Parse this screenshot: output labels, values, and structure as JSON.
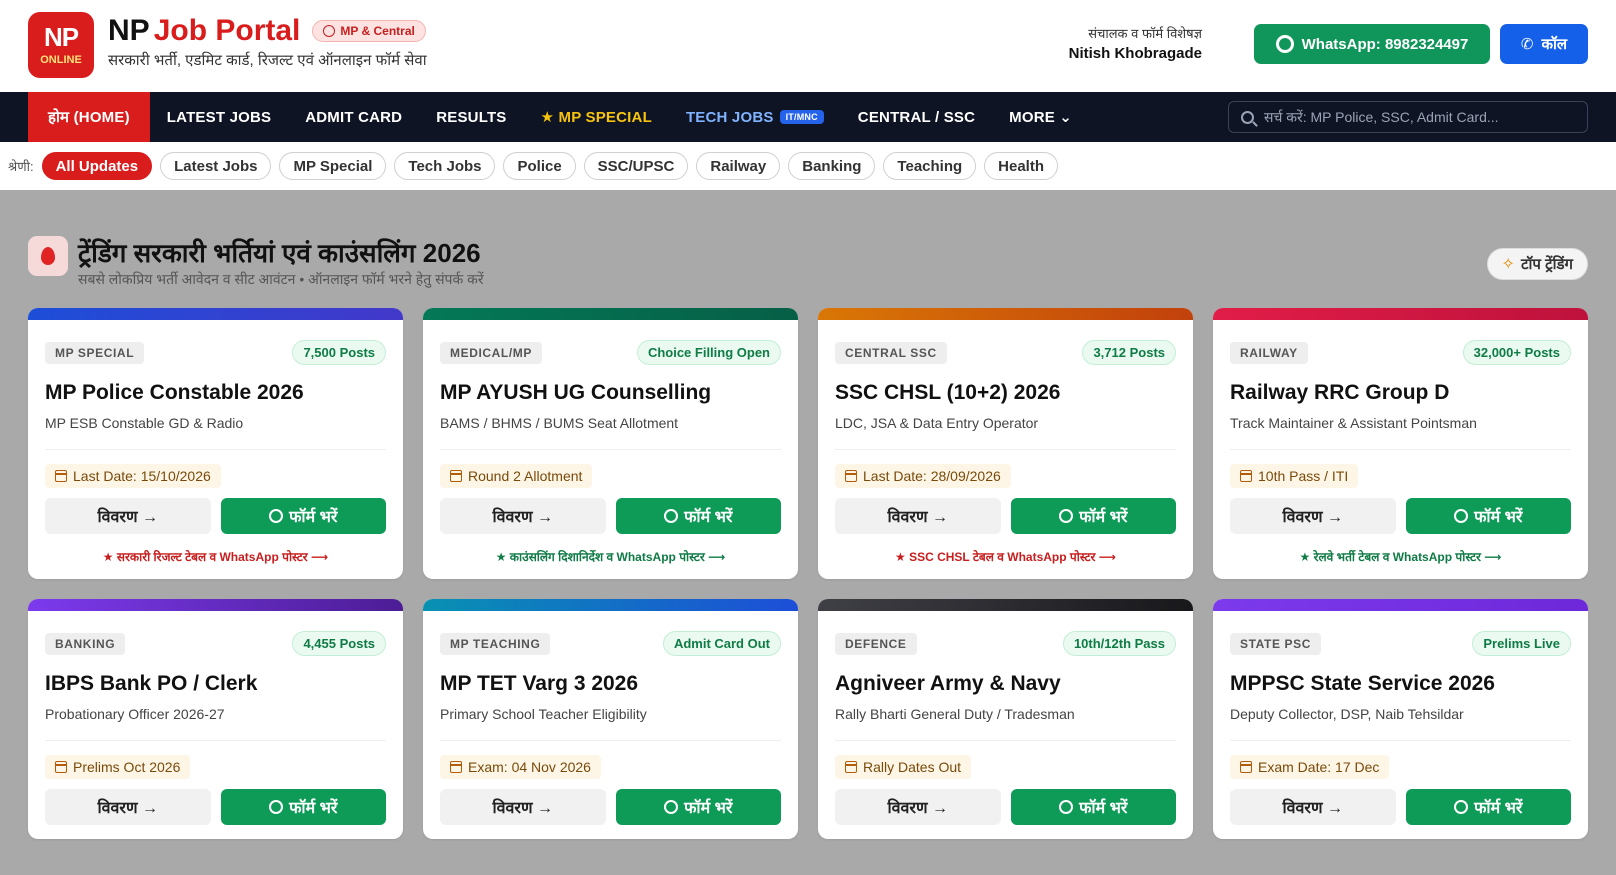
{
  "header": {
    "logo_line1": "NP",
    "logo_line2": "ONLINE",
    "brand_np": "NP",
    "brand_jp": "Job Portal",
    "badge": "MP & Central",
    "subtitle": "सरकारी भर्ती, एडमिट कार्ड, रिजल्ट एवं ऑनलाइन फॉर्म सेवा",
    "director_label": "संचालक व फॉर्म विशेषज्ञ",
    "director_name": "Nitish Khobragade",
    "whatsapp": "WhatsApp: 8982324497",
    "call": "कॉल"
  },
  "nav": {
    "home": "होम (HOME)",
    "latest": "LATEST JOBS",
    "admit": "ADMIT CARD",
    "results": "RESULTS",
    "special": "★ MP SPECIAL",
    "tech": "TECH JOBS",
    "tech_badge": "IT/MNC",
    "central": "CENTRAL / SSC",
    "more": "MORE ⌄",
    "search_placeholder": "सर्च करें: MP Police, SSC, Admit Card..."
  },
  "categories": {
    "label": "श्रेणी:",
    "items": [
      "All Updates",
      "Latest Jobs",
      "MP Special",
      "Tech Jobs",
      "Police",
      "SSC/UPSC",
      "Railway",
      "Banking",
      "Teaching",
      "Health"
    ]
  },
  "section": {
    "title": "ट्रेंडिंग सरकारी भर्तियां एवं काउंसलिंग 2026",
    "subtitle": "सबसे लोकप्रिय भर्ती आवेदन व सीट आवंटन • ऑनलाइन फॉर्म भरने हेतु संपर्क करें",
    "top_trending": "टॉप ट्रेंडिंग"
  },
  "colors": {
    "accent_red": "#d91c1c",
    "whatsapp_green": "#10965a",
    "call_blue": "#1560e8",
    "nav_bg": "#0f1424"
  },
  "cards": [
    {
      "tag": "MP SPECIAL",
      "posts": "7,500 Posts",
      "title": "MP Police Constable 2026",
      "sub": "MP ESB Constable GD & Radio",
      "date": "Last Date: 15/10/2026",
      "details": "विवरण →",
      "fill": "फॉर्म भरें",
      "note": "★ सरकारी रिजल्ट टेबल व WhatsApp पोस्टर ⟶",
      "bar": "#1d4ed8,#4338ca"
    },
    {
      "tag": "MEDICAL/MP",
      "posts": "Choice Filling Open",
      "title": "MP AYUSH UG Counselling",
      "sub": "BAMS / BHMS / BUMS Seat Allotment",
      "date": "Round 2 Allotment",
      "details": "विवरण →",
      "fill": "फॉर्म भरें",
      "note": "★ काउंसलिंग दिशानिर्देश व WhatsApp पोस्टर ⟶",
      "bar": "#047857,#065f46"
    },
    {
      "tag": "CENTRAL SSC",
      "posts": "3,712 Posts",
      "title": "SSC CHSL (10+2) 2026",
      "sub": "LDC, JSA & Data Entry Operator",
      "date": "Last Date: 28/09/2026",
      "details": "विवरण →",
      "fill": "फॉर्म भरें",
      "note": "★ SSC CHSL टेबल व WhatsApp पोस्टर ⟶",
      "bar": "#d97706,#c2410c"
    },
    {
      "tag": "RAILWAY",
      "posts": "32,000+ Posts",
      "title": "Railway RRC Group D",
      "sub": "Track Maintainer & Assistant Pointsman",
      "date": "10th Pass / ITI",
      "details": "विवरण →",
      "fill": "फॉर्म भरें",
      "note": "★ रेलवे भर्ती टेबल व WhatsApp पोस्टर ⟶",
      "bar": "#e11d48,#be123c"
    },
    {
      "tag": "BANKING",
      "posts": "4,455 Posts",
      "title": "IBPS Bank PO / Clerk",
      "sub": "Probationary Officer 2026-27",
      "date": "Prelims Oct 2026",
      "details": "विवरण →",
      "fill": "फॉर्म भरें",
      "note": "",
      "bar": "#7c3aed,#4c1d95"
    },
    {
      "tag": "MP TEACHING",
      "posts": "Admit Card Out",
      "title": "MP TET Varg 3 2026",
      "sub": "Primary School Teacher Eligibility",
      "date": "Exam: 04 Nov 2026",
      "details": "विवरण →",
      "fill": "फॉर्म भरें",
      "note": "",
      "bar": "#0891b2,#1d4ed8"
    },
    {
      "tag": "DEFENCE",
      "posts": "10th/12th Pass",
      "title": "Agniveer Army & Navy",
      "sub": "Rally Bharti General Duty / Tradesman",
      "date": "Rally Dates Out",
      "details": "विवरण →",
      "fill": "फॉर्म भरें",
      "note": "",
      "bar": "#3f3f46,#18181b"
    },
    {
      "tag": "STATE PSC",
      "posts": "Prelims Live",
      "title": "MPPSC State Service 2026",
      "sub": "Deputy Collector, DSP, Naib Tehsildar",
      "date": "Exam Date: 17 Dec",
      "details": "विवरण →",
      "fill": "फॉर्म भरें",
      "note": "",
      "bar": "#7c3aed,#6d28d9"
    }
  ]
}
